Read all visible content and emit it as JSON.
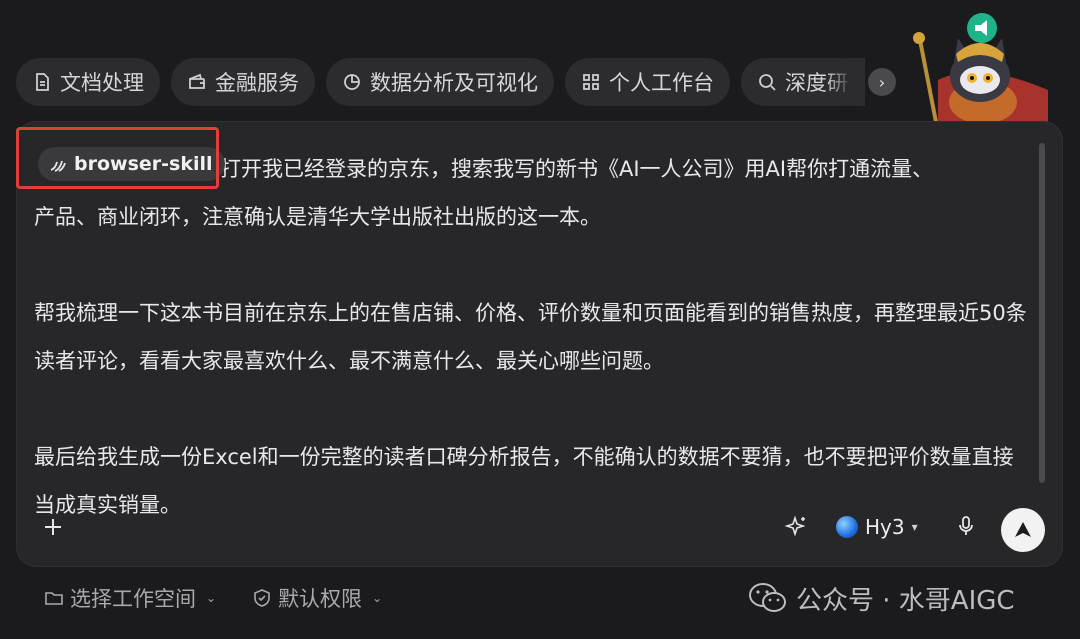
{
  "chips": [
    {
      "label": "文档处理",
      "icon": "document-icon"
    },
    {
      "label": "金融服务",
      "icon": "wallet-icon"
    },
    {
      "label": "数据分析及可视化",
      "icon": "pie-chart-icon"
    },
    {
      "label": "个人工作台",
      "icon": "grid-icon"
    },
    {
      "label": "深度研",
      "icon": "search-icon"
    }
  ],
  "skill_tag": {
    "label": "browser-skill",
    "icon": "skill-icon"
  },
  "prompt": {
    "line1": "打开我已经登录的京东，搜索我写的新书《AI一人公司》用AI帮你打通流量、",
    "line2": "产品、商业闭环，注意确认是清华大学出版社出版的这一本。",
    "para2": "帮我梳理一下这本书目前在京东上的在售店铺、价格、评价数量和页面能看到的销售热度，再整理最近50条读者评论，看看大家最喜欢什么、最不满意什么、最关心哪些问题。",
    "para3": "最后给我生成一份Excel和一份完整的读者口碑分析报告，不能确认的数据不要猜，也不要把评价数量直接当成真实销量。"
  },
  "model": {
    "name": "Hy3"
  },
  "bottom": {
    "workspace_label": "选择工作空间",
    "permission_label": "默认权限"
  },
  "watermark": {
    "text": "公众号 · 水哥AIGC"
  },
  "colors": {
    "highlight": "#e0403c",
    "background": "#1b1b1d",
    "panel": "#272729"
  }
}
